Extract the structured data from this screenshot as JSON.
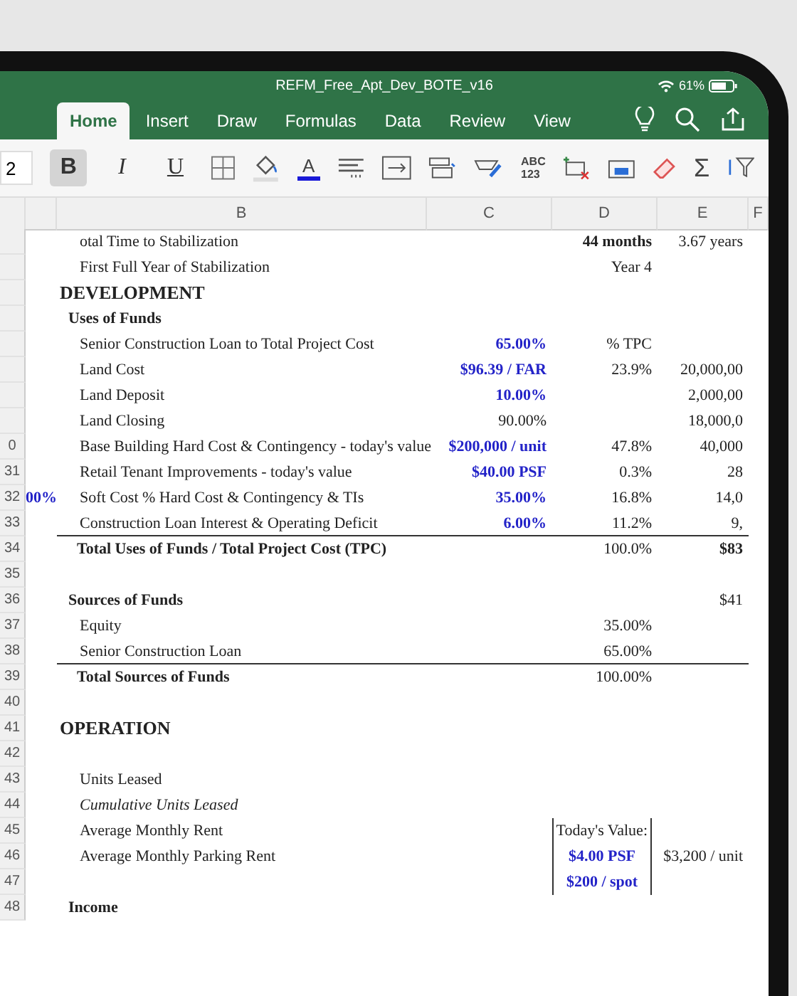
{
  "window": {
    "title": "REFM_Free_Apt_Dev_BOTE_v16"
  },
  "status_bar": {
    "battery": "61%"
  },
  "tabs": [
    {
      "label": "Home",
      "selected": true
    },
    {
      "label": "Insert",
      "selected": false
    },
    {
      "label": "Draw",
      "selected": false
    },
    {
      "label": "Formulas",
      "selected": false
    },
    {
      "label": "Data",
      "selected": false
    },
    {
      "label": "Review",
      "selected": false
    },
    {
      "label": "View",
      "selected": false
    }
  ],
  "toolbar": {
    "font_size": "2",
    "styles": [
      {
        "label": "B",
        "selected": true
      },
      {
        "label": "I",
        "selected": false
      },
      {
        "label": "U",
        "selected": false
      }
    ],
    "font_color": "A",
    "spelling": [
      "ABC",
      "123"
    ],
    "sum": "Σ"
  },
  "columns": [
    "B",
    "C",
    "D",
    "E",
    "F"
  ],
  "rows": [
    {
      "num": "",
      "kind": "item",
      "label": "otal Time to Stabilization",
      "d": {
        "text": "44 months",
        "kind": "bold"
      },
      "e": {
        "text": "3.67 years",
        "kind": "plain"
      }
    },
    {
      "num": "",
      "kind": "item",
      "label": "First Full Year of Stabilization",
      "d": {
        "text": "Year 4",
        "kind": "plain"
      }
    },
    {
      "num": "",
      "kind": "title",
      "label": "DEVELOPMENT"
    },
    {
      "num": "",
      "kind": "section",
      "label": "Uses of Funds"
    },
    {
      "num": "",
      "kind": "item",
      "label": "Senior Construction Loan to Total Project Cost",
      "c": {
        "text": "65.00%",
        "kind": "input"
      },
      "d": {
        "text": "% TPC",
        "kind": "plain"
      }
    },
    {
      "num": "",
      "kind": "item",
      "label": "Land Cost",
      "c": {
        "text": "$96.39 / FAR",
        "kind": "input"
      },
      "d": {
        "text": "23.9%",
        "kind": "plain"
      },
      "e": {
        "text": "20,000,00",
        "kind": "plain"
      }
    },
    {
      "num": "",
      "kind": "item",
      "label": "Land Deposit",
      "c": {
        "text": "10.00%",
        "kind": "input"
      },
      "e": {
        "text": "2,000,00",
        "kind": "plain"
      }
    },
    {
      "num": "",
      "kind": "item",
      "label": "Land Closing",
      "c": {
        "text": "90.00%",
        "kind": "plain"
      },
      "e": {
        "text": "18,000,0",
        "kind": "plain"
      }
    },
    {
      "num": "0",
      "kind": "item",
      "label": "Base Building Hard Cost & Contingency - today's value",
      "c": {
        "text": "$200,000 / unit",
        "kind": "input"
      },
      "d": {
        "text": "47.8%",
        "kind": "plain"
      },
      "e": {
        "text": "40,000",
        "kind": "plain"
      }
    },
    {
      "num": "31",
      "kind": "item",
      "label": "Retail Tenant Improvements - today's value",
      "c": {
        "text": "$40.00 PSF",
        "kind": "input"
      },
      "d": {
        "text": "0.3%",
        "kind": "plain"
      },
      "e": {
        "text": "28",
        "kind": "plain"
      }
    },
    {
      "num": "32",
      "a": "00%",
      "kind": "item",
      "label": "Soft Cost % Hard Cost & Contingency & TIs",
      "c": {
        "text": "35.00%",
        "kind": "input"
      },
      "d": {
        "text": "16.8%",
        "kind": "plain"
      },
      "e": {
        "text": "14,0",
        "kind": "plain"
      }
    },
    {
      "num": "33",
      "kind": "item",
      "rule": true,
      "label": "Construction Loan Interest & Operating Deficit",
      "c": {
        "text": "6.00%",
        "kind": "input"
      },
      "d": {
        "text": "11.2%",
        "kind": "plain"
      },
      "e": {
        "text": "9,",
        "kind": "plain"
      }
    },
    {
      "num": "34",
      "kind": "total",
      "label": "Total Uses of Funds / Total Project Cost (TPC)",
      "d": {
        "text": "100.0%",
        "kind": "plain"
      },
      "e": {
        "text": "$83",
        "kind": "bold"
      }
    },
    {
      "num": "35"
    },
    {
      "num": "36",
      "kind": "section",
      "label": "Sources of Funds",
      "e": {
        "text": "$41",
        "kind": "plain"
      }
    },
    {
      "num": "37",
      "kind": "item",
      "label": "Equity",
      "d": {
        "text": "35.00%",
        "kind": "plain"
      }
    },
    {
      "num": "38",
      "kind": "item",
      "rule": true,
      "label": "Senior Construction Loan",
      "d": {
        "text": "65.00%",
        "kind": "plain"
      }
    },
    {
      "num": "39",
      "kind": "total",
      "label": "Total Sources of Funds",
      "d": {
        "text": "100.00%",
        "kind": "plain"
      }
    },
    {
      "num": "40"
    },
    {
      "num": "41",
      "kind": "title",
      "label": "OPERATION"
    },
    {
      "num": "42"
    },
    {
      "num": "43",
      "kind": "item",
      "label": "Units Leased"
    },
    {
      "num": "44",
      "kind": "italic",
      "label": "Cumulative Units Leased"
    },
    {
      "num": "45",
      "kind": "item",
      "label": "Average Monthly Rent",
      "d": {
        "text": "Today's Value:",
        "kind": "boxed"
      }
    },
    {
      "num": "46",
      "kind": "item",
      "label": "Average Monthly Parking Rent",
      "d": {
        "text": "$4.00 PSF",
        "kind": "boxed-input"
      },
      "e": {
        "text": "$3,200 / unit",
        "kind": "plain"
      }
    },
    {
      "num": "47",
      "d": {
        "text": "$200 / spot",
        "kind": "boxed-input"
      }
    },
    {
      "num": "48",
      "kind": "section",
      "label": "Income"
    }
  ]
}
